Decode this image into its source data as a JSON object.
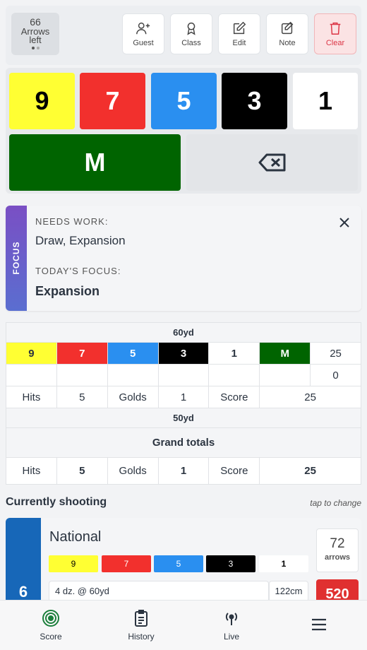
{
  "header": {
    "arrows_left_count": "66",
    "arrows_left_label_1": "Arrows",
    "arrows_left_label_2": "left",
    "buttons": {
      "guest": "Guest",
      "class": "Class",
      "edit": "Edit",
      "note": "Note",
      "clear": "Clear"
    }
  },
  "keypad": {
    "keys": [
      "9",
      "7",
      "5",
      "3",
      "1"
    ],
    "miss": "M",
    "backspace_icon": "backspace-icon"
  },
  "focus": {
    "strip_label": "FOCUS",
    "needs_work_label": "NEEDS WORK:",
    "needs_work_value": "Draw, Expansion",
    "todays_focus_label": "TODAY'S FOCUS:",
    "todays_focus_value": "Expansion"
  },
  "scoresheet": {
    "distance_1": "60yd",
    "end_values": [
      "9",
      "7",
      "5",
      "3",
      "1",
      "M"
    ],
    "end_total": "25",
    "running_total": "0",
    "summary": {
      "hits_label": "Hits",
      "hits": "5",
      "golds_label": "Golds",
      "golds": "1",
      "score_label": "Score",
      "score": "25"
    },
    "distance_2": "50yd",
    "grand_totals_label": "Grand totals",
    "grand": {
      "hits_label": "Hits",
      "hits": "5",
      "golds_label": "Golds",
      "golds": "1",
      "score_label": "Score",
      "score": "25"
    }
  },
  "current": {
    "title": "Currently shooting",
    "hint": "tap to change",
    "round_number": "6",
    "round_name": "National",
    "mini_keys": [
      "9",
      "7",
      "5",
      "3",
      "1"
    ],
    "distance": "4 dz. @ 60yd",
    "face": "122cm",
    "arrows": "72",
    "arrows_label": "arrows",
    "max_score": "520"
  },
  "nav": {
    "score": "Score",
    "history": "History",
    "live": "Live"
  }
}
